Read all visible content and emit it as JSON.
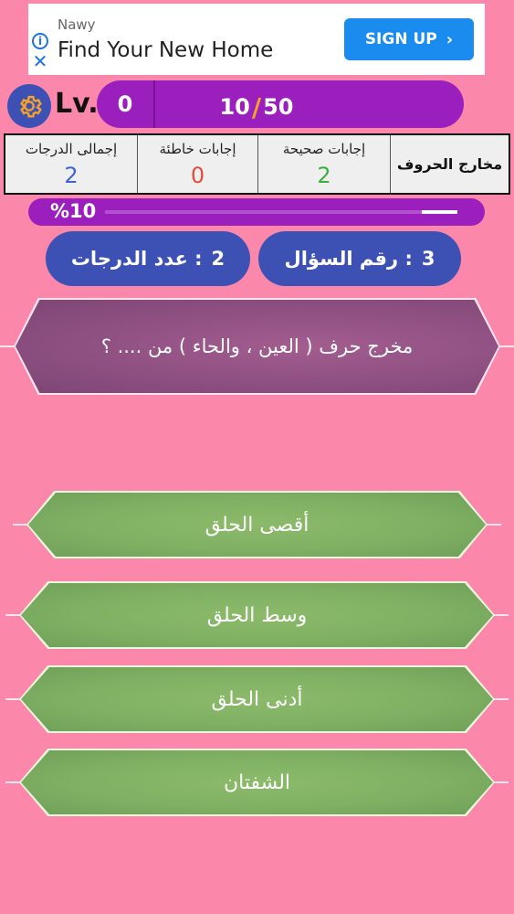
{
  "ad": {
    "brand": "Nawy",
    "headline": "Find Your New Home",
    "cta_label": "SIGN UP",
    "info_icon": "info-icon",
    "close_icon": "close-icon"
  },
  "header": {
    "level_label": "Lv.",
    "level_value": "0",
    "progress_current": "10",
    "progress_separator": "/",
    "progress_total": "50"
  },
  "stats": {
    "category": "مخارج الحروف",
    "correct_label": "إجابات صحيحة",
    "correct_value": "2",
    "wrong_label": "إجابات خاطئة",
    "wrong_value": "0",
    "total_label": "إجمالى الدرجات",
    "total_value": "2"
  },
  "progress": {
    "percent_label": "%10",
    "fraction": 0.1
  },
  "info": {
    "question_number_label": "رقم السؤال :",
    "question_number_value": "3",
    "score_count_label": "عدد الدرجات :",
    "score_count_value": "2"
  },
  "question": {
    "text": "مخرج حرف ( العين ، والحاء ) من .... ؟"
  },
  "answers": [
    {
      "text": "أقصى الحلق"
    },
    {
      "text": "وسط الحلق"
    },
    {
      "text": "أدنى الحلق"
    },
    {
      "text": "الشفتان"
    }
  ],
  "colors": {
    "background": "#fb87ab",
    "purple": "#9b1fbd",
    "blue": "#3d51b5",
    "answer_green": "#7fb063",
    "question_mauve": "#8c4f80",
    "correct_green": "#3cae3c",
    "wrong_red": "#e34b3b",
    "total_blue": "#3d63d6",
    "slash_orange": "#f4a12a"
  }
}
